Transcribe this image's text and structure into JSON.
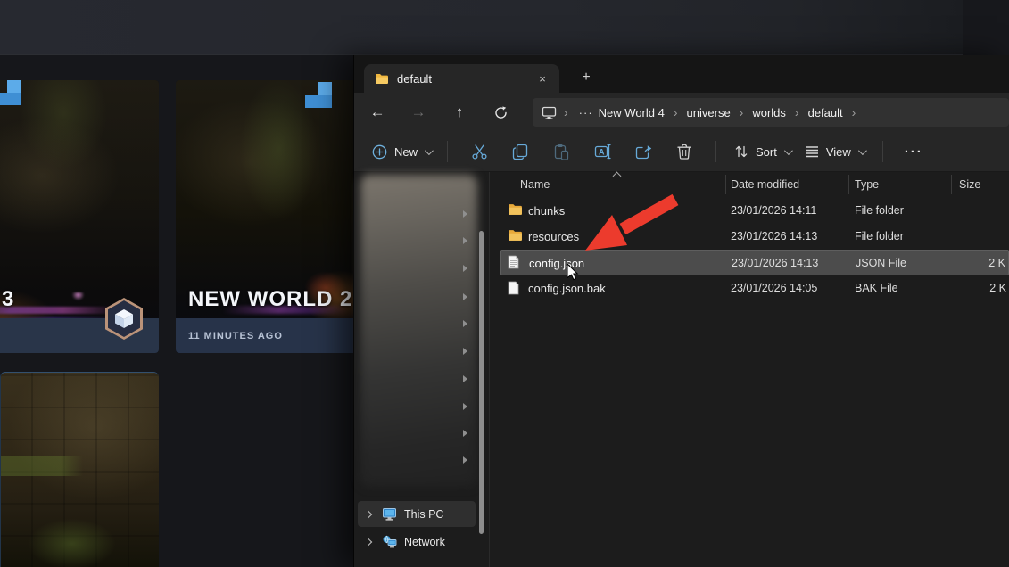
{
  "game": {
    "world3_title_fragment": "3",
    "world2": {
      "title": "NEW WORLD 2",
      "subtitle": "11 MINUTES AGO"
    }
  },
  "window": {
    "tab": "default",
    "tab_close": "×",
    "new_tab": "+",
    "nav": {
      "back": "←",
      "forward": "→",
      "up": "↑"
    },
    "address_overflow": "···",
    "breadcrumbs": [
      "New World 4",
      "universe",
      "worlds",
      "default"
    ],
    "toolbar": {
      "new": "New",
      "sort": "Sort",
      "view": "View",
      "more": "···"
    },
    "columns": {
      "name": "Name",
      "date": "Date modified",
      "type": "Type",
      "size": "Size"
    },
    "files": [
      {
        "name": "chunks",
        "kind": "folder",
        "date": "23/01/2026 14:11",
        "type": "File folder",
        "size": ""
      },
      {
        "name": "resources",
        "kind": "folder",
        "date": "23/01/2026 14:13",
        "type": "File folder",
        "size": ""
      },
      {
        "name": "config.json",
        "kind": "file",
        "date": "23/01/2026 14:13",
        "type": "JSON File",
        "size": "2 K",
        "selected": true
      },
      {
        "name": "config.json.bak",
        "kind": "file",
        "date": "23/01/2026 14:05",
        "type": "BAK File",
        "size": "2 K"
      }
    ],
    "sidebar": {
      "this_pc": "This PC",
      "network": "Network"
    }
  },
  "colors": {
    "selection_gray": "#4c4c4c",
    "arrow_red": "#ec3b2d",
    "folder_yellow": "#eeb33e",
    "command_blue": "#66aede",
    "card_footer_navy": "#273349",
    "pixel_blue": "#4896db",
    "hex_border_tan": "#bb9379"
  },
  "icons": [
    "folder-icon",
    "file-icon",
    "back-icon",
    "forward-icon",
    "up-icon",
    "refresh-icon",
    "this-pc-icon",
    "network-icon",
    "new-plus-icon",
    "cut-icon",
    "copy-icon",
    "paste-icon",
    "rename-icon",
    "share-icon",
    "delete-icon",
    "sort-icon",
    "view-icon",
    "more-icon",
    "cube-badge-icon",
    "red-arrow-annotation",
    "mouse-cursor"
  ]
}
